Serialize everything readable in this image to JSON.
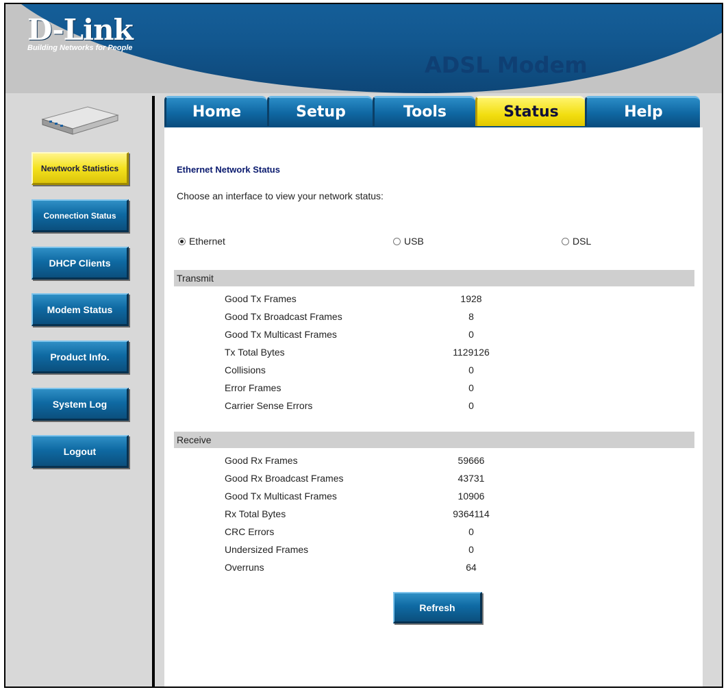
{
  "header": {
    "brand": "D-Link",
    "tagline": "Building Networks for People",
    "product": "ADSL Modem"
  },
  "tabs": [
    {
      "label": "Home",
      "active": false
    },
    {
      "label": "Setup",
      "active": false
    },
    {
      "label": "Tools",
      "active": false
    },
    {
      "label": "Status",
      "active": true
    },
    {
      "label": "Help",
      "active": false
    }
  ],
  "sidebar": {
    "items": [
      {
        "label": "Newtwork Statistics",
        "active": true
      },
      {
        "label": "Connection Status",
        "active": false
      },
      {
        "label": "DHCP Clients",
        "active": false
      },
      {
        "label": "Modem Status",
        "active": false
      },
      {
        "label": "Product Info.",
        "active": false
      },
      {
        "label": "System Log",
        "active": false
      },
      {
        "label": "Logout",
        "active": false
      }
    ]
  },
  "main": {
    "title": "Ethernet Network Status",
    "intro": "Choose an interface to view your network status:",
    "interfaces": [
      {
        "label": "Ethernet",
        "selected": true
      },
      {
        "label": "USB",
        "selected": false
      },
      {
        "label": "DSL",
        "selected": false
      }
    ],
    "transmit": {
      "title": "Transmit",
      "rows": [
        {
          "label": "Good Tx Frames",
          "value": "1928"
        },
        {
          "label": "Good Tx Broadcast Frames",
          "value": "8"
        },
        {
          "label": "Good Tx Multicast Frames",
          "value": "0"
        },
        {
          "label": "Tx Total Bytes",
          "value": "1129126"
        },
        {
          "label": "Collisions",
          "value": "0"
        },
        {
          "label": "Error Frames",
          "value": "0"
        },
        {
          "label": "Carrier Sense Errors",
          "value": "0"
        }
      ]
    },
    "receive": {
      "title": "Receive",
      "rows": [
        {
          "label": "Good Rx Frames",
          "value": "59666"
        },
        {
          "label": "Good Rx Broadcast Frames",
          "value": "43731"
        },
        {
          "label": "Good Tx Multicast Frames",
          "value": "10906"
        },
        {
          "label": "Rx Total Bytes",
          "value": "9364114"
        },
        {
          "label": "CRC Errors",
          "value": "0"
        },
        {
          "label": "Undersized Frames",
          "value": "0"
        },
        {
          "label": "Overruns",
          "value": "64"
        }
      ]
    },
    "refresh_label": "Refresh"
  },
  "colors": {
    "brand_blue": "#12578f",
    "active_yellow": "#f4e21e",
    "title_navy": "#0a1a6e"
  }
}
